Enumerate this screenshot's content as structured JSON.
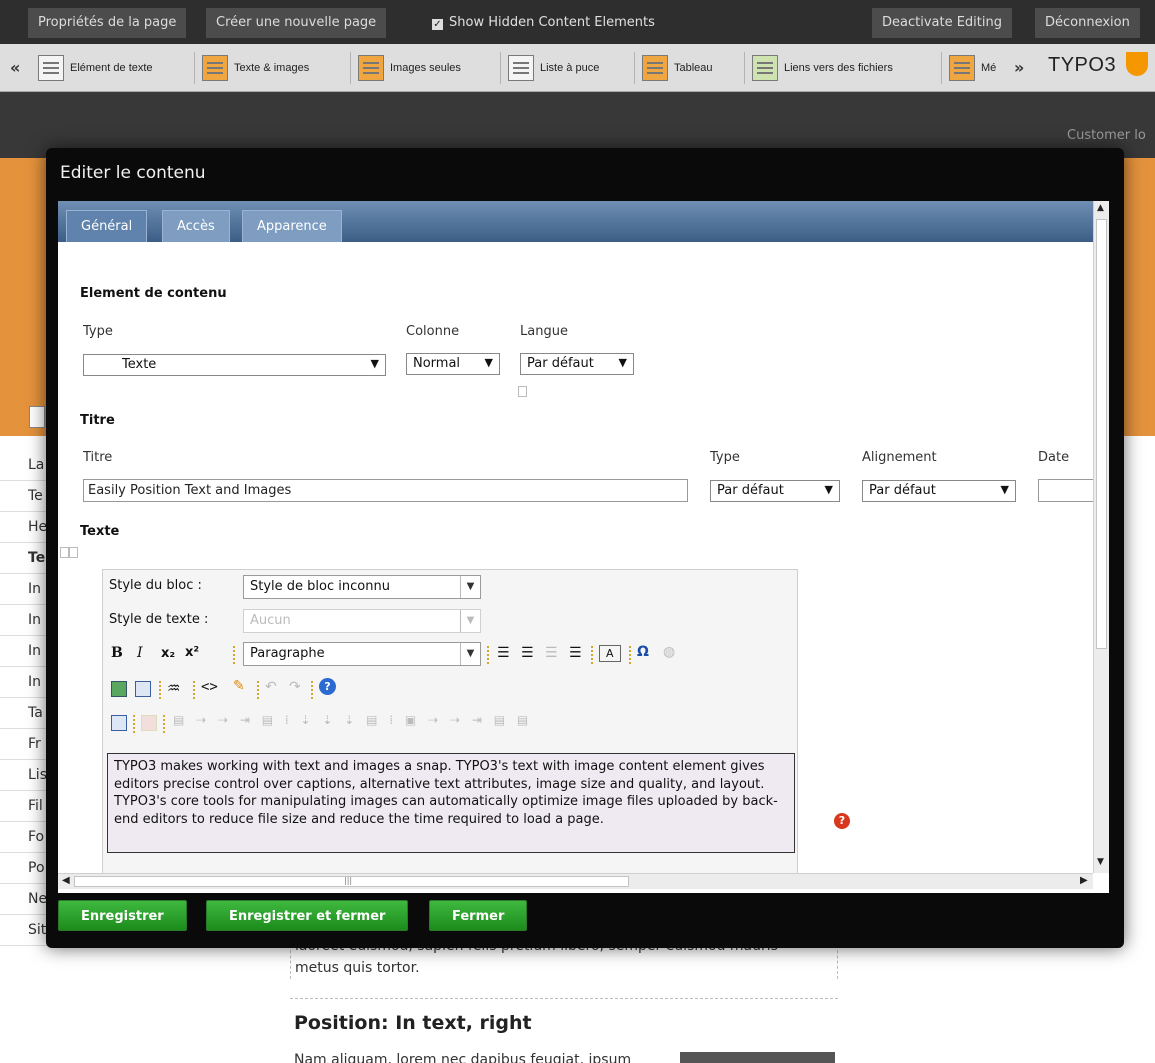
{
  "topbar": {
    "page_properties": "Propriétés de la page",
    "new_page": "Créer une nouvelle page",
    "show_hidden": "Show Hidden Content Elements",
    "deactivate": "Deactivate Editing",
    "logout": "Déconnexion"
  },
  "elements_bar": {
    "prev": "«",
    "next": "»",
    "items": [
      "Elément de texte",
      "Texte & images",
      "Images seules",
      "Liste à puce",
      "Tableau",
      "Liens vers des fichiers",
      "Mé"
    ],
    "logo": "TYPO3"
  },
  "page": {
    "customer_login": "Customer lo",
    "nav": [
      "La",
      "Te",
      "He",
      "Te",
      "In",
      "In",
      "In",
      "In",
      "Ta",
      "Fr",
      "Lis",
      "Fil",
      "Fo",
      "Po",
      "Ne",
      "Site map"
    ],
    "body_text_line1": "laoreet euismod, sapien felis pretium libero, semper euismod mauris",
    "body_text_line2": "metus quis tortor.",
    "heading": "Position: In text, right",
    "tail_text": "Nam aliquam, lorem nec dapibus feugiat, ipsum"
  },
  "modal": {
    "title": "Editer le contenu",
    "tabs": [
      "Général",
      "Accès",
      "Apparence"
    ],
    "section_content": "Element de contenu",
    "type_label": "Type",
    "type_value": "Texte",
    "colonne_label": "Colonne",
    "colonne_value": "Normal",
    "langue_label": "Langue",
    "langue_value": "Par défaut",
    "section_titre": "Titre",
    "titre_label": "Titre",
    "titre_value": "Easily Position Text and Images",
    "titre_type_label": "Type",
    "titre_type_value": "Par défaut",
    "alignement_label": "Alignement",
    "alignement_value": "Par défaut",
    "date_label": "Date",
    "section_texte": "Texte",
    "rte": {
      "block_style_label": "Style du bloc :",
      "block_style_value": "Style de bloc inconnu",
      "text_style_label": "Style de texte :",
      "text_style_value": "Aucun",
      "format_value": "Paragraphe",
      "content": "TYPO3 makes working with text and images a snap. TYPO3's text with image content element gives editors precise control over captions, alternative text attributes, image size and quality, and layout. TYPO3's core tools for manipulating images can automatically optimize image files uploaded by back-end editors to reduce file size and reduce the time required to load a page."
    },
    "buttons": {
      "save": "Enregistrer",
      "save_close": "Enregistrer et fermer",
      "close": "Fermer"
    }
  },
  "colors": {
    "modal_bg": "#0a0a0a",
    "tab_blue": "#5f83ad",
    "button_green": "#2aa12a",
    "orange_band": "#e4923c",
    "help_red": "#d9381e"
  }
}
